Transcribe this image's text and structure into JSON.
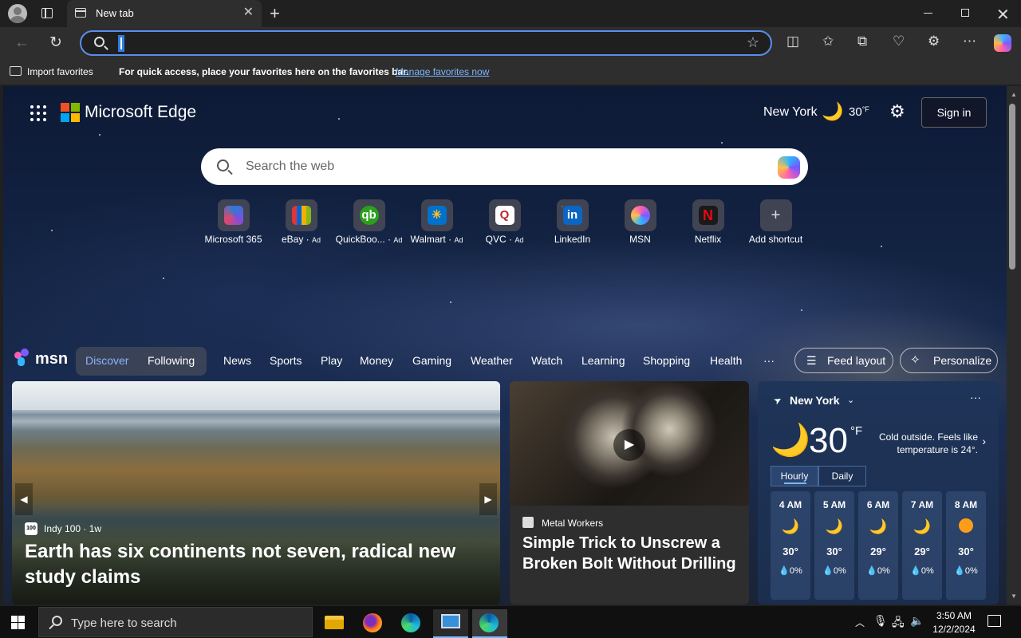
{
  "browser": {
    "tab_title": "New tab",
    "address_value": "",
    "favorites": {
      "import_label": "Import favorites",
      "message": "For quick access, place your favorites here on the favorites bar.",
      "manage_link": "Manage favorites now"
    }
  },
  "header": {
    "brand": "Microsoft Edge",
    "city": "New York",
    "temp": "30",
    "temp_unit": "°F",
    "signin_label": "Sign in"
  },
  "search": {
    "placeholder": "Search the web"
  },
  "shortcuts": [
    {
      "label": "Microsoft 365",
      "ad": ""
    },
    {
      "label": "eBay",
      "ad": "Ad"
    },
    {
      "label": "QuickBoo...",
      "ad": "Ad"
    },
    {
      "label": "Walmart",
      "ad": "Ad"
    },
    {
      "label": "QVC",
      "ad": "Ad"
    },
    {
      "label": "LinkedIn",
      "ad": ""
    },
    {
      "label": "MSN",
      "ad": ""
    },
    {
      "label": "Netflix",
      "ad": ""
    },
    {
      "label": "Add shortcut",
      "ad": ""
    }
  ],
  "msn": {
    "logo_text": "msn",
    "discover": "Discover",
    "following": "Following",
    "nav": [
      "News",
      "Sports",
      "Play",
      "Money",
      "Gaming",
      "Weather",
      "Watch",
      "Learning",
      "Shopping",
      "Health"
    ],
    "more": "···",
    "feed_layout": "Feed layout",
    "personalize": "Personalize"
  },
  "cards": {
    "main": {
      "source_icon": "100",
      "source": "Indy 100 · 1w",
      "title": "Earth has six continents not seven, radical new study claims"
    },
    "video": {
      "source": "Metal Workers",
      "title": "Simple Trick to Unscrew a Broken Bolt Without Drilling"
    }
  },
  "weather": {
    "city": "New York",
    "temp": "30",
    "unit": "°F",
    "description": "Cold outside. Feels like temperature is 24°.",
    "tab_hourly": "Hourly",
    "tab_daily": "Daily",
    "hours": [
      {
        "time": "4 AM",
        "icon": "moon-icon",
        "temp": "30°",
        "precip": "0%"
      },
      {
        "time": "5 AM",
        "icon": "moon-icon",
        "temp": "30°",
        "precip": "0%"
      },
      {
        "time": "6 AM",
        "icon": "moon-icon",
        "temp": "29°",
        "precip": "0%"
      },
      {
        "time": "7 AM",
        "icon": "moon-icon",
        "temp": "29°",
        "precip": "0%"
      },
      {
        "time": "8 AM",
        "icon": "sun-icon",
        "temp": "30°",
        "precip": "0%"
      }
    ]
  },
  "taskbar": {
    "search_placeholder": "Type here to search",
    "time": "3:50 AM",
    "date": "12/2/2024"
  },
  "colors": {
    "accent": "#5a8dee",
    "link": "#7ab7ff",
    "moon": "#ffb52e"
  }
}
